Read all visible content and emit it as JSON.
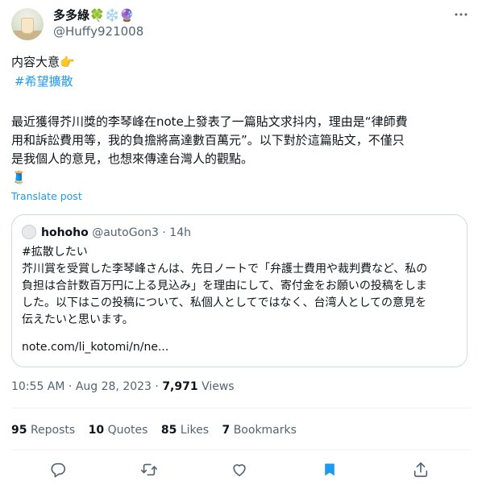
{
  "author": {
    "display_name": "多多綠🍀❄️🔮",
    "handle": "@Huffy921008"
  },
  "post": {
    "intro_line": "内容大意👉",
    "hashtag": "#希望擴散",
    "lines": [
      "最近獲得芥川獎的李琴峰在note上發表了一篇貼文求抖内，理由是“律師費",
      "用和訴訟費用等，我的負擔將高達數百萬元”。以下對於這篇貼文，不僅只",
      "是我個人的意見，也想來傳達台灣人的觀點。"
    ],
    "emoji_line": "🧵",
    "translate_label": "Translate post"
  },
  "quote": {
    "name": "hohoho",
    "handle": "@autoGon3",
    "separator": "·",
    "time": "14h",
    "lines": [
      "#拡散したい",
      "芥川賞を受賞した李琴峰さんは、先日ノートで「弁護士費用や裁判費など、私の",
      "負担は合計数百万円に上る見込み」を理由にして、寄付金をお願いの投稿をしま",
      "した。以下はこの投稿について、私個人としてではなく、台湾人としての意見を",
      "伝えたいと思います。",
      "",
      "note.com/li_kotomi/n/ne..."
    ]
  },
  "meta": {
    "time": "10:55 AM",
    "separator": "·",
    "date": "Aug 28, 2023",
    "separator2": "·",
    "views_count": "7,971",
    "views_label": "Views"
  },
  "stats": {
    "reposts_count": "95",
    "reposts_label": "Reposts",
    "quotes_count": "10",
    "quotes_label": "Quotes",
    "likes_count": "85",
    "likes_label": "Likes",
    "bookmarks_count": "7",
    "bookmarks_label": "Bookmarks"
  },
  "colors": {
    "accent": "#1d9bf0",
    "secondary_text": "#536471",
    "border": "#cfd9de"
  },
  "icons": {
    "more": "more-horizontal-icon",
    "reply": "reply-icon",
    "repost": "repost-icon",
    "like": "heart-icon",
    "bookmark": "bookmark-filled-icon",
    "share": "share-icon"
  }
}
